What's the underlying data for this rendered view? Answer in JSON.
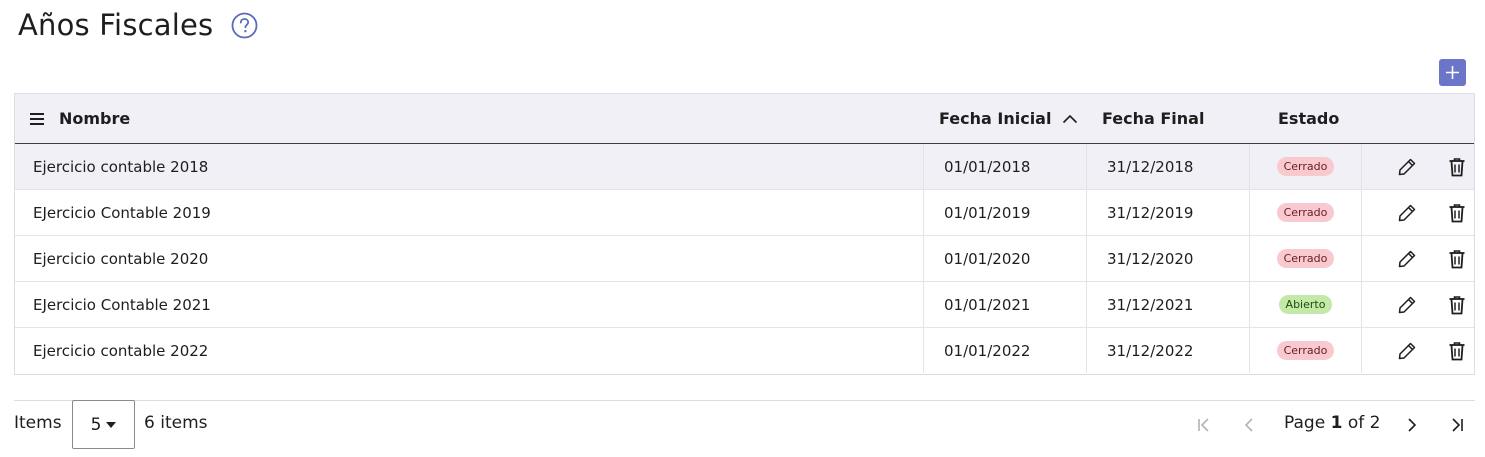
{
  "page": {
    "title": "Años Fiscales"
  },
  "columns": {
    "nombre": "Nombre",
    "fecha_inicial": "Fecha Inicial",
    "fecha_final": "Fecha Final",
    "estado": "Estado"
  },
  "rows": [
    {
      "nombre": "Ejercicio contable 2018",
      "fecha_inicial": "01/01/2018",
      "fecha_final": "31/12/2018",
      "estado": "Cerrado"
    },
    {
      "nombre": "EJercicio Contable 2019",
      "fecha_inicial": "01/01/2019",
      "fecha_final": "31/12/2019",
      "estado": "Cerrado"
    },
    {
      "nombre": "Ejercicio contable 2020",
      "fecha_inicial": "01/01/2020",
      "fecha_final": "31/12/2020",
      "estado": "Cerrado"
    },
    {
      "nombre": "EJercicio Contable 2021",
      "fecha_inicial": "01/01/2021",
      "fecha_final": "31/12/2021",
      "estado": "Abierto"
    },
    {
      "nombre": "Ejercicio contable 2022",
      "fecha_inicial": "01/01/2022",
      "fecha_final": "31/12/2022",
      "estado": "Cerrado"
    }
  ],
  "status_colors": {
    "Cerrado": {
      "bg": "#f8c9cf",
      "fg": "#6a1d25"
    },
    "Abierto": {
      "bg": "#c4e8a7",
      "fg": "#1f4a10"
    }
  },
  "pager": {
    "items_label": "Items",
    "page_size": "5",
    "item_count": "6 items",
    "page_word": "Page",
    "current_page": "1",
    "of_word": "of",
    "total_pages": "2"
  },
  "colors": {
    "accent": "#6b76c9",
    "header_bg": "#f0f0f6"
  },
  "icons": {
    "help": "question-circle-icon",
    "add": "plus-icon",
    "menu": "hamburger-menu-icon",
    "sort": "sort-ascending-chevron-icon",
    "edit": "pencil-icon",
    "delete": "trash-icon",
    "first": "first-page-icon",
    "prev": "previous-page-icon",
    "next": "next-page-icon",
    "last": "last-page-icon",
    "dropdown": "caret-down-icon"
  }
}
